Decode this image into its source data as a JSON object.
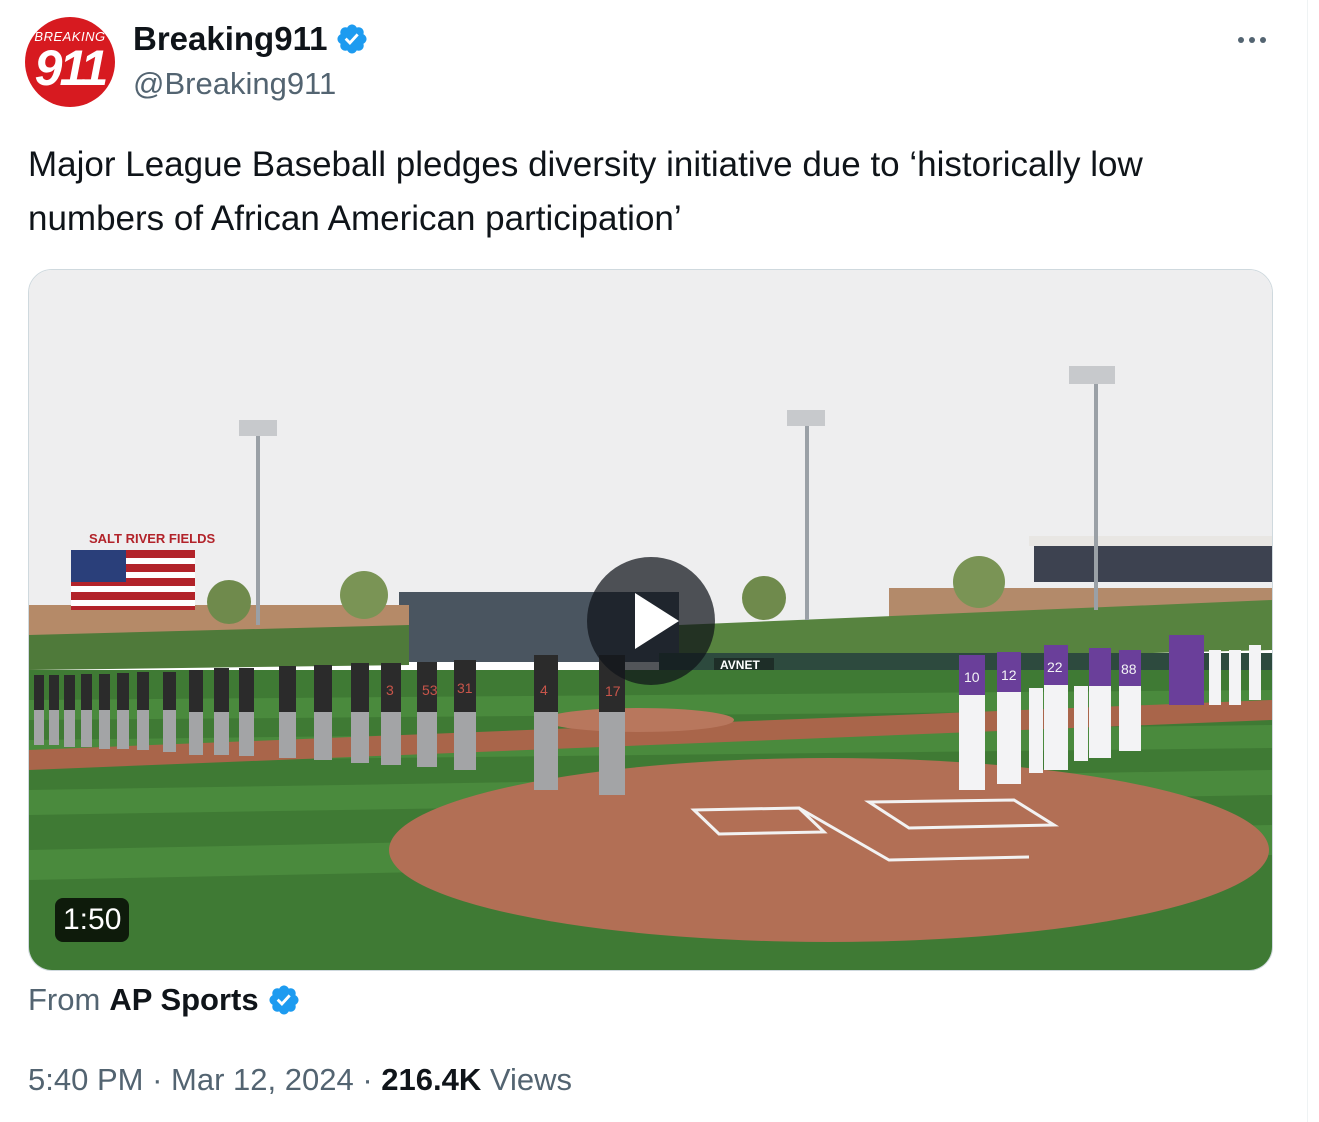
{
  "author": {
    "avatar_text_small": "BREAKING",
    "avatar_text_big": "911",
    "display_name": "Breaking911",
    "handle": "@Breaking911",
    "verified_icon": "verified-badge-icon",
    "more_icon": "more-options-icon"
  },
  "tweet": {
    "text": "Major League Baseball pledges diversity initiative due to ‘historically low numbers of African American participation’"
  },
  "media": {
    "duration": "1:50",
    "play_icon": "play-icon",
    "image_text": {
      "stadium_sign": "SALT RIVER FIELDS",
      "ad_board": "AVNET",
      "jersey_numbers_left": [
        "3",
        "53",
        "31",
        "4",
        "17"
      ],
      "jersey_numbers_right": [
        "10",
        "12",
        "22",
        "88"
      ]
    }
  },
  "source": {
    "from_label": "From",
    "name": "AP Sports"
  },
  "meta": {
    "time": "5:40 PM",
    "separator": "·",
    "date": "Mar 12, 2024",
    "views_count": "216.4K",
    "views_label": "Views"
  },
  "colors": {
    "text_primary": "#0f1419",
    "text_secondary": "#536471",
    "verified_blue": "#1d9bf0",
    "avatar_red": "#d71a20"
  }
}
